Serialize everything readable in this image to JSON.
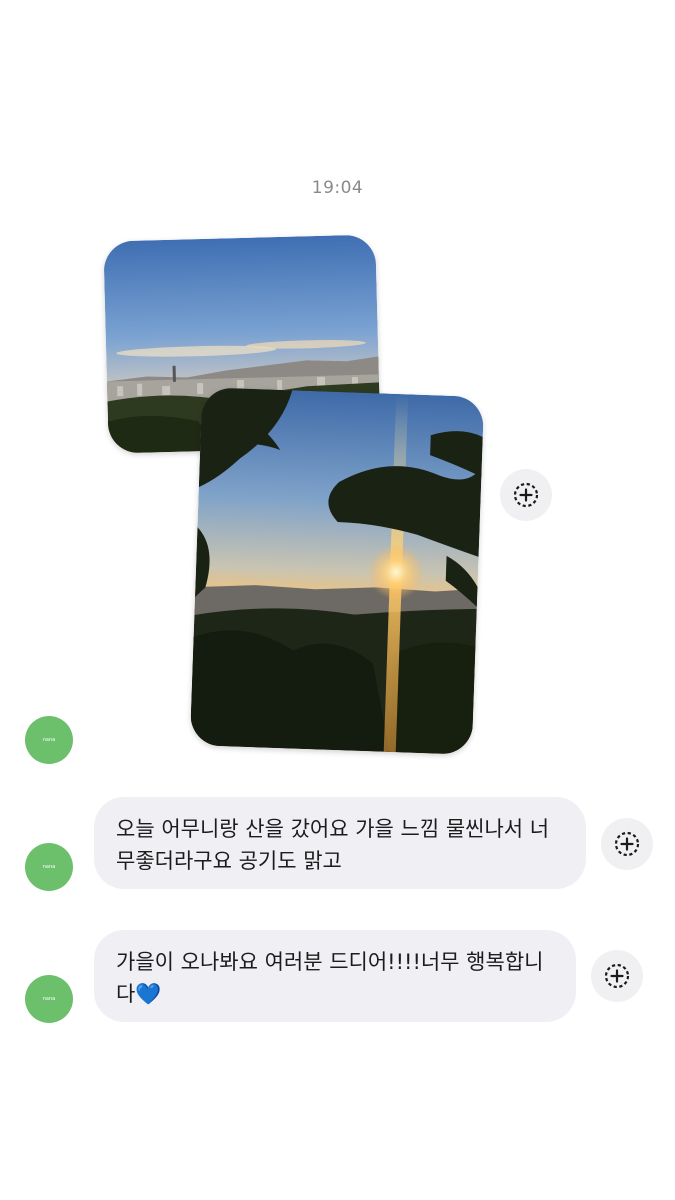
{
  "chat": {
    "timestamp": "19:04",
    "avatar_label": "nana",
    "messages": [
      {
        "type": "photo-group",
        "photos": [
          "city-skyline-photo",
          "sunset-pine-photo"
        ]
      },
      {
        "type": "text",
        "lines": [
          "오늘 어무니랑 산을 갔어요 가을 느낌 물씬나서 너",
          "무좋더라구요 공기도 맑고"
        ]
      },
      {
        "type": "text",
        "lines": [
          "가을이 오나봐요 여러분 드디어!!!!너무 행복합니",
          "다💙"
        ]
      }
    ]
  },
  "icons": {
    "react": "add-reaction-icon"
  },
  "colors": {
    "avatar": "#6cc06b",
    "bubble": "#f0f0f4",
    "react_button": "#f0f0f3",
    "timestamp": "#8a8a8a"
  }
}
